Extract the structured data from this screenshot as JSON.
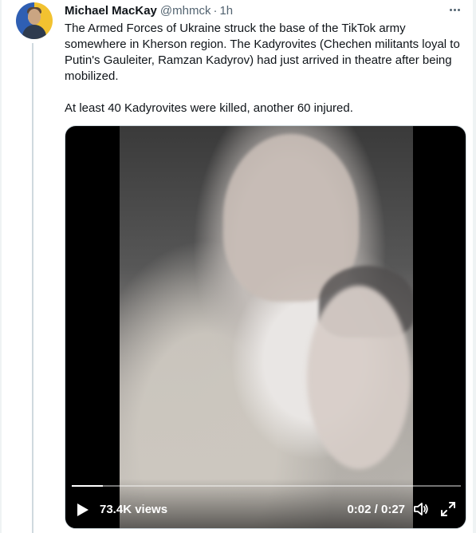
{
  "tweet": {
    "author_name": "Michael MacKay",
    "author_handle": "@mhmck",
    "separator": "·",
    "time": "1h",
    "text_paragraphs": [
      "The Armed Forces of Ukraine struck the base of the TikTok army somewhere in Kherson region. The Kadyrovites (Chechen militants loyal to Putin's Gauleiter, Ramzan Kadyrov) had just arrived in theatre after being mobilized.",
      "At least 40 Kadyrovites were killed, another 60 injured."
    ]
  },
  "video": {
    "views": "73.4K views",
    "time_display": "0:02 / 0:27",
    "progress": 0.08
  },
  "icons": {
    "more": "more-icon",
    "play": "play-icon",
    "volume": "volume-icon",
    "fullscreen": "fullscreen-icon"
  }
}
